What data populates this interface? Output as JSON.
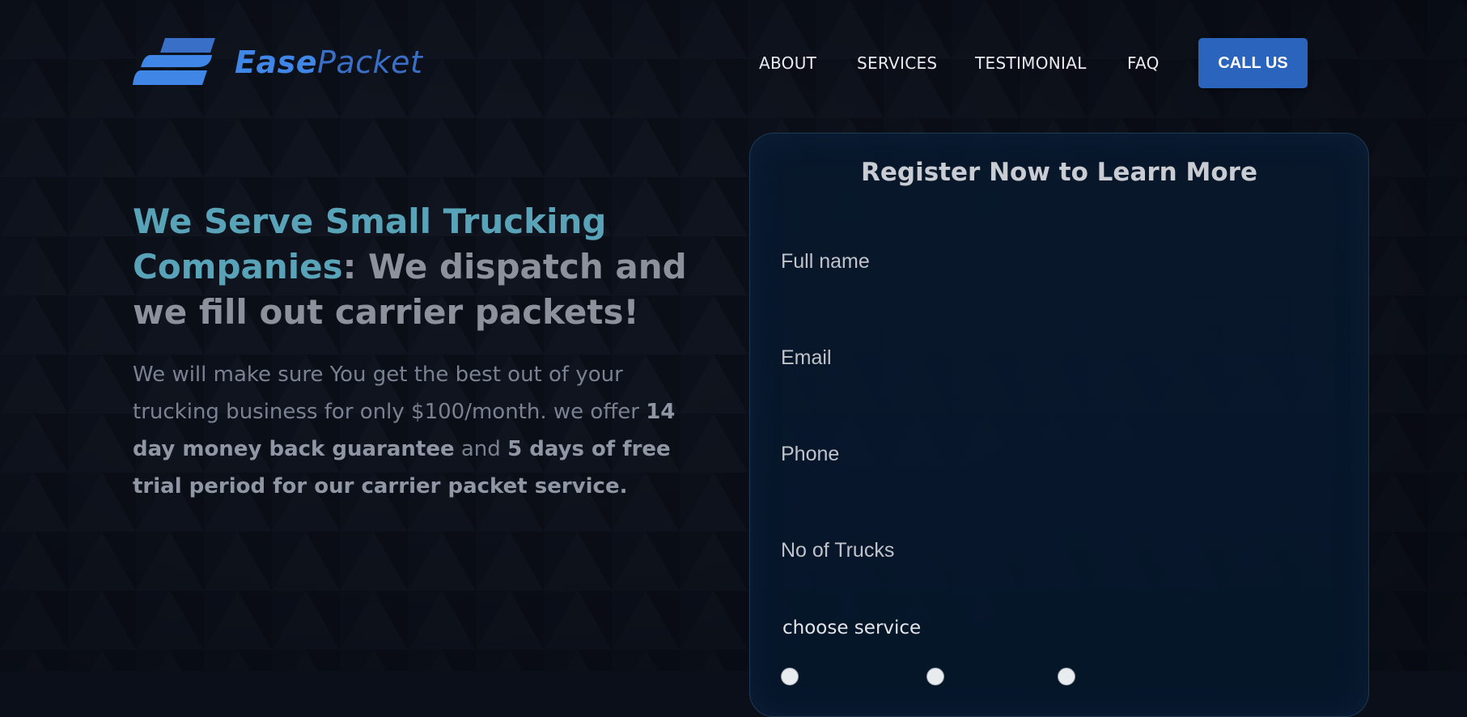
{
  "brand": {
    "name_part1": "Ease",
    "name_part2": "Packet",
    "color_primary": "#3f86e6",
    "color_secondary": "#3a6fc7"
  },
  "nav": {
    "items": [
      {
        "label": "ABOUT"
      },
      {
        "label": "SERVICES"
      },
      {
        "label": "TESTIMONIAL"
      },
      {
        "label": "FAQ"
      }
    ],
    "cta_label": "CALL US",
    "cta_color": "#2a64bd"
  },
  "hero": {
    "title_highlight": "We Serve Small Trucking Companies",
    "title_rest": ": We dispatch and we fill out carrier packets!",
    "highlight_color": "#58a3b8",
    "text_part1": "We will make sure You get the best out of your trucking business for only $100/month. we offer ",
    "text_bold1": "14 day money back guarantee",
    "text_part2": " and ",
    "text_bold2": "5 days of free trial period for our carrier packet service."
  },
  "form": {
    "title": "Register Now to Learn More",
    "fields": [
      {
        "placeholder": "Full name",
        "value": ""
      },
      {
        "placeholder": "Email",
        "value": ""
      },
      {
        "placeholder": "Phone",
        "value": ""
      },
      {
        "placeholder": "No of Trucks",
        "value": ""
      }
    ],
    "choose_service_label": "choose service",
    "service_options": [
      {
        "icon": "radio-icon",
        "selected": false
      },
      {
        "icon": "radio-icon",
        "selected": false
      },
      {
        "icon": "radio-icon",
        "selected": false
      }
    ]
  }
}
